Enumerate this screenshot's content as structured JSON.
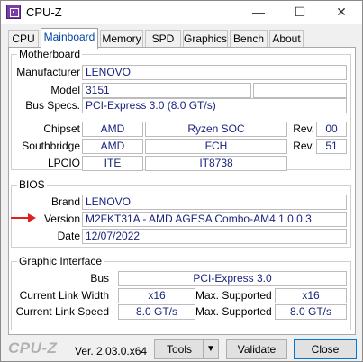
{
  "window": {
    "title": "CPU-Z",
    "icons": {
      "app": "cpu-z-app-icon",
      "minimize": "minimize-icon",
      "maximize": "maximize-icon",
      "close": "close-icon"
    },
    "min_glyph": "—",
    "max_glyph": "☐",
    "close_glyph": "✕"
  },
  "tabs": [
    {
      "label": "CPU"
    },
    {
      "label": "Mainboard"
    },
    {
      "label": "Memory"
    },
    {
      "label": "SPD"
    },
    {
      "label": "Graphics"
    },
    {
      "label": "Bench"
    },
    {
      "label": "About"
    }
  ],
  "active_tab": "Mainboard",
  "motherboard": {
    "legend": "Motherboard",
    "manufacturer_label": "Manufacturer",
    "manufacturer": "LENOVO",
    "model_label": "Model",
    "model": "3151",
    "model_extra": "",
    "bus_specs_label": "Bus Specs.",
    "bus_specs": "PCI-Express 3.0 (8.0 GT/s)",
    "chipset_label": "Chipset",
    "chipset_vendor": "AMD",
    "chipset_model": "Ryzen SOC",
    "chipset_rev_label": "Rev.",
    "chipset_rev": "00",
    "southbridge_label": "Southbridge",
    "southbridge_vendor": "AMD",
    "southbridge_model": "FCH",
    "southbridge_rev_label": "Rev.",
    "southbridge_rev": "51",
    "lpcio_label": "LPCIO",
    "lpcio_vendor": "ITE",
    "lpcio_model": "IT8738"
  },
  "bios": {
    "legend": "BIOS",
    "brand_label": "Brand",
    "brand": "LENOVO",
    "version_label": "Version",
    "version": "M2FKT31A - AMD AGESA Combo-AM4 1.0.0.3",
    "date_label": "Date",
    "date": "12/07/2022",
    "annotation": {
      "icon": "red-arrow-icon",
      "color": "#e02020"
    }
  },
  "graphic_interface": {
    "legend": "Graphic Interface",
    "bus_label": "Bus",
    "bus": "PCI-Express 3.0",
    "current_link_width_label": "Current Link Width",
    "current_link_width": "x16",
    "max_supported_width_label": "Max. Supported",
    "max_supported_width": "x16",
    "current_link_speed_label": "Current Link Speed",
    "current_link_speed": "8.0 GT/s",
    "max_supported_speed_label": "Max. Supported",
    "max_supported_speed": "8.0 GT/s"
  },
  "footer": {
    "brand": "CPU-Z",
    "version": "Ver. 2.03.0.x64",
    "tools_label": "Tools",
    "tools_dropdown_glyph": "▼",
    "validate_label": "Validate",
    "close_label": "Close"
  },
  "colors": {
    "value_text": "#1a237e",
    "active_tab_text": "#0046a0",
    "arrow": "#e02020"
  }
}
